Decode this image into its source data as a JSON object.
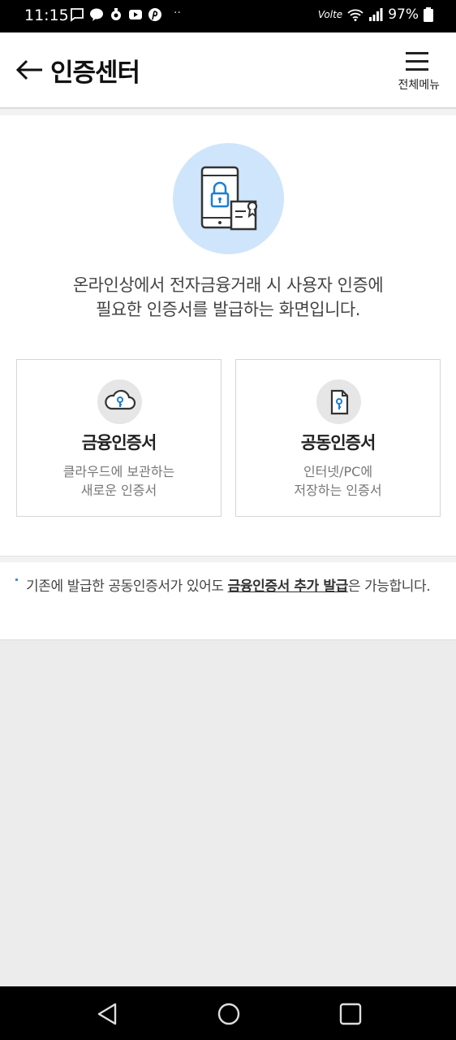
{
  "status_bar": {
    "time": "11:15",
    "volte": "Volte",
    "battery": "97%",
    "dots": "··"
  },
  "header": {
    "title": "인증센터",
    "menu_label": "전체메뉴"
  },
  "main": {
    "intro_line1": "온라인상에서 전자금융거래 시 사용자 인증에",
    "intro_line2": "필요한 인증서를 발급하는 화면입니다.",
    "cards": [
      {
        "title": "금융인증서",
        "desc_line1": "클라우드에 보관하는",
        "desc_line2": "새로운 인증서",
        "icon": "cloud-key-icon"
      },
      {
        "title": "공동인증서",
        "desc_line1": "인터넷/PC에",
        "desc_line2": "저장하는 인증서",
        "icon": "document-key-icon"
      }
    ]
  },
  "notice": {
    "text_before": "기존에 발급한 공동인증서가 있어도 ",
    "link_text": "금융인증서 추가 발급",
    "text_after": "은 가능합니다."
  },
  "colors": {
    "accent_blue": "#1a7fd1",
    "hero_bg": "#cfe5fb"
  }
}
